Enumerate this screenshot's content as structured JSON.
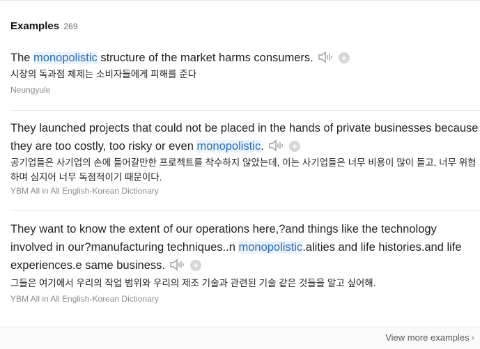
{
  "header": {
    "title": "Examples",
    "count": "269"
  },
  "examples": [
    {
      "en_before": "The ",
      "en_highlight": "monopolistic",
      "en_after": " structure of the market harms consumers.",
      "ko": "시장의 독과점 체제는 소비자들에게 피해를 준다",
      "source": "Neungyule"
    },
    {
      "en_before": "They launched projects that could not be placed in the hands of private businesses because they are too costly, too risky or even ",
      "en_highlight": "monopolistic",
      "en_after": ".",
      "ko": "공기업들은 사기업의 손에 들어갈만한 프로젝트를 착수하지 않았는데, 이는 사기업들은 너무 비용이 많이 들고, 너무 위험하며 심지어 너무 독점적이기 때문이다.",
      "source": "YBM All in All English-Korean Dictionary"
    },
    {
      "en_before": "They want to know the extent of our operations here,?and things like the technology involved in our?manufacturing techniques..n ",
      "en_highlight": "monopolistic",
      "en_after": ".alities and life histories.and life experiences.e same business.",
      "ko": "그들은 여기에서 우리의 작업 범위와 우리의 제조 기술과 관련된 기술 같은 것들을 알고 싶어해.",
      "source": "YBM All in All English-Korean Dictionary"
    }
  ],
  "icons": {
    "speaker": "speaker-icon",
    "add": "plus-icon",
    "chevron": "chevron-right-icon"
  },
  "plus_glyph": "+",
  "footer": {
    "view_more": "View more examples",
    "chevron": "›"
  },
  "colors": {
    "highlight_bg": "#e9f3fb",
    "highlight_text": "#2a6bb8",
    "source": "#8c8c8c"
  }
}
